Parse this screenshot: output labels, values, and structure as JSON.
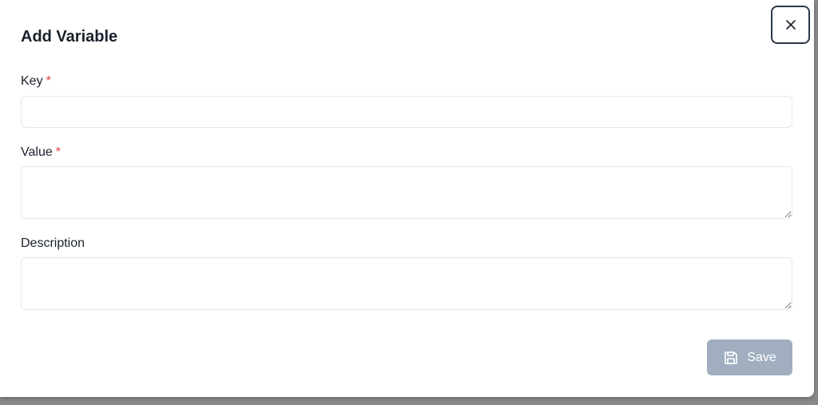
{
  "dialog": {
    "title": "Add Variable",
    "close_icon": "close-icon"
  },
  "fields": {
    "key": {
      "label": "Key",
      "required_marker": "*",
      "value": "",
      "placeholder": ""
    },
    "value": {
      "label": "Value",
      "required_marker": "*",
      "value": "",
      "placeholder": ""
    },
    "description": {
      "label": "Description",
      "value": "",
      "placeholder": ""
    }
  },
  "actions": {
    "save_label": "Save",
    "save_icon": "save-icon",
    "save_disabled": true
  },
  "colors": {
    "required": "#e53e3e",
    "save_button_disabled": "#a0aec0",
    "text": "#1a202c",
    "input_border": "#e2e8f0"
  }
}
